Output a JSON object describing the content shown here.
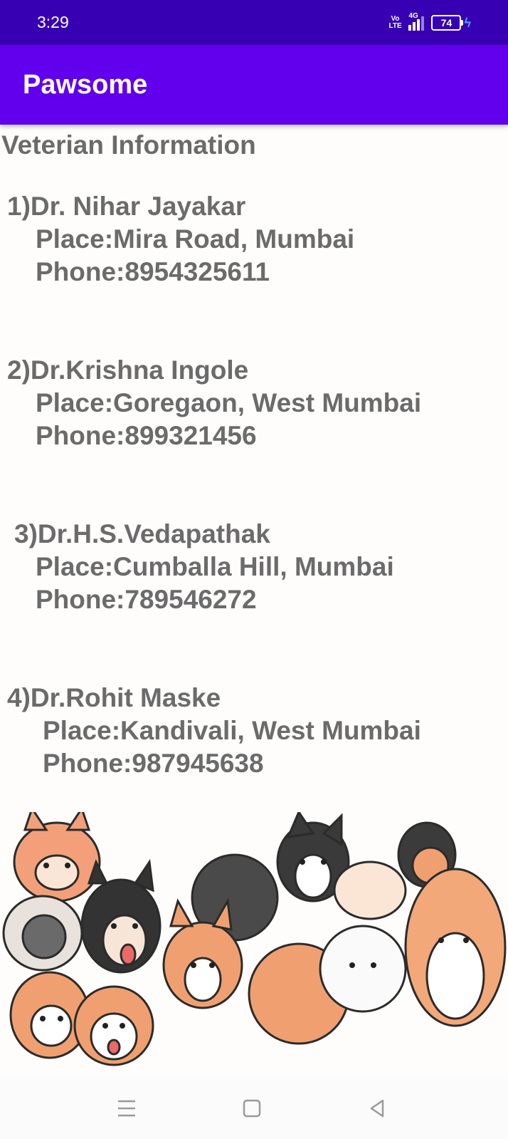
{
  "status": {
    "time": "3:29",
    "volte": "Vo\nLTE",
    "network": "4G",
    "battery": "74"
  },
  "app": {
    "title": "Pawsome"
  },
  "page": {
    "heading": "Veterian Information"
  },
  "vets": [
    {
      "name": "1)Dr. Nihar Jayakar",
      "place": "Place:Mira Road, Mumbai",
      "phone": "Phone:8954325611"
    },
    {
      "name": "2)Dr.Krishna Ingole",
      "place": "Place:Goregaon, West Mumbai",
      "phone": "Phone:899321456"
    },
    {
      "name": "3)Dr.H.S.Vedapathak",
      "place": "Place:Cumballa Hill, Mumbai",
      "phone": "Phone:789546272"
    },
    {
      "name": "4)Dr.Rohit Maske",
      "place": "Place:Kandivali, West Mumbai",
      "phone": "Phone:987945638"
    }
  ],
  "nav": {
    "icons": [
      "menu-icon",
      "home-icon",
      "back-icon"
    ]
  }
}
